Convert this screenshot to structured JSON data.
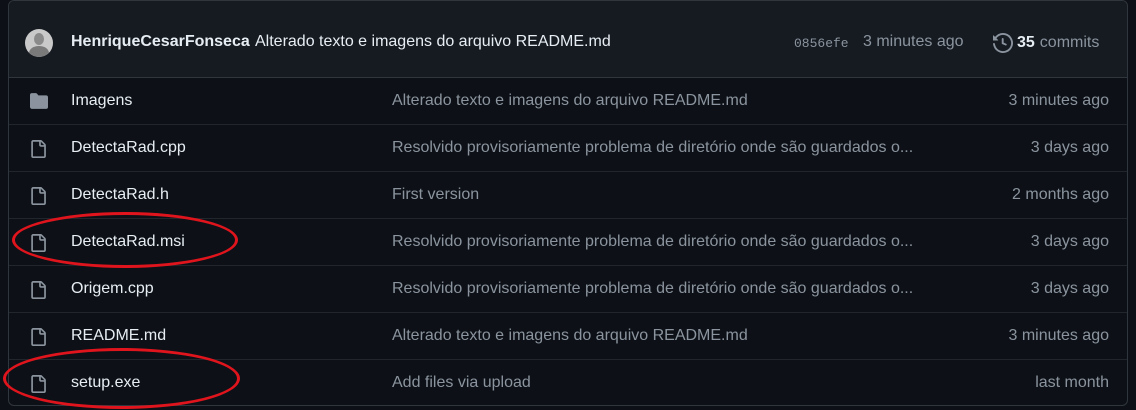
{
  "commit": {
    "author": "HenriqueCesarFonseca",
    "message": "Alterado texto e imagens do arquivo README.md",
    "sha": "0856efe",
    "time": "3 minutes ago",
    "commit_count": "35",
    "commits_label": "commits"
  },
  "files": [
    {
      "type": "folder",
      "name": "Imagens",
      "message": "Alterado texto e imagens do arquivo README.md",
      "time": "3 minutes ago"
    },
    {
      "type": "file",
      "name": "DetectaRad.cpp",
      "message": "Resolvido provisoriamente problema de diretório onde são guardados o...",
      "time": "3 days ago"
    },
    {
      "type": "file",
      "name": "DetectaRad.h",
      "message": "First version",
      "time": "2 months ago"
    },
    {
      "type": "file",
      "name": "DetectaRad.msi",
      "message": "Resolvido provisoriamente problema de diretório onde são guardados o...",
      "time": "3 days ago"
    },
    {
      "type": "file",
      "name": "Origem.cpp",
      "message": "Resolvido provisoriamente problema de diretório onde são guardados o...",
      "time": "3 days ago"
    },
    {
      "type": "file",
      "name": "README.md",
      "message": "Alterado texto e imagens do arquivo README.md",
      "time": "3 minutes ago"
    },
    {
      "type": "file",
      "name": "setup.exe",
      "message": "Add files via upload",
      "time": "last month"
    }
  ],
  "highlight_color": "#e0141c",
  "highlighted_files": [
    "DetectaRad.msi",
    "setup.exe"
  ]
}
